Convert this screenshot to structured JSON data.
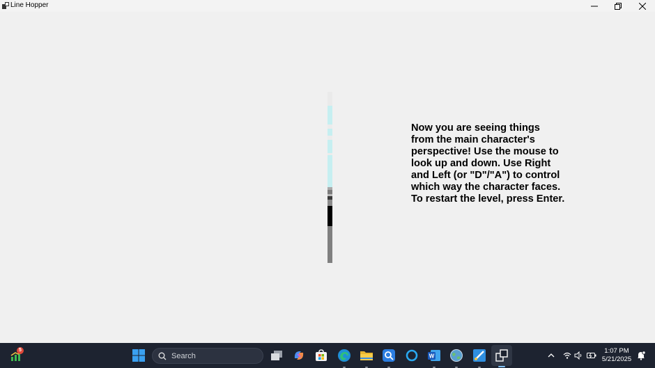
{
  "window": {
    "title": "Line Hopper",
    "controls": [
      "minimize",
      "restore",
      "close"
    ]
  },
  "game": {
    "instructions": " Now you are seeing things\nfrom the main character's\nperspective! Use the mouse to\nlook up and down. Use Right\nand Left (or \"D\"/\"A\") to control\nwhich way the character faces.\nTo restart the level, press Enter.",
    "view_colors": [
      "#eeeeee",
      "#c8f0f0",
      "#808080",
      "#000000"
    ]
  },
  "taskbar": {
    "notification_badge": "5",
    "search_placeholder": "Search",
    "apps": [
      "start",
      "search",
      "task-view",
      "copilot",
      "microsoft-store",
      "edge",
      "file-explorer",
      "screen-capture",
      "cortana",
      "word",
      "globe-app",
      "paint",
      "line-hopper"
    ],
    "time": "1:07 PM",
    "date": "5/21/2025"
  }
}
